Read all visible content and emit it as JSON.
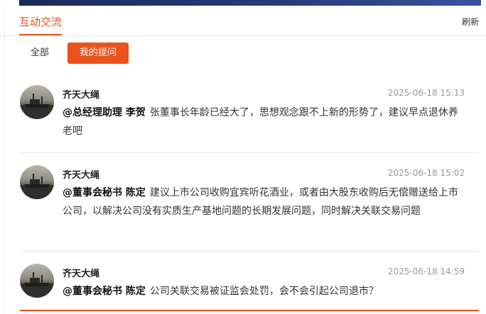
{
  "header": {
    "title": "互动交流",
    "refresh_label": "刷新"
  },
  "tabs": {
    "all_label": "全部",
    "mine_label": "我的提问"
  },
  "posts": [
    {
      "user": "齐天大绳",
      "time": "2025-06-18 15:13",
      "mention": "@总经理助理 李贺",
      "text": "张董事长年龄已经大了，思想观念跟不上新的形势了，建议早点退休养老吧"
    },
    {
      "user": "齐天大绳",
      "time": "2025-06-18 15:02",
      "mention": "@董事会秘书 陈定",
      "text": "建议上市公司收购宜宾听花酒业，或者由大股东收购后无偿赠送给上市公司，以解决公司没有实质生产基地问题的长期发展问题，同时解决关联交易问题"
    },
    {
      "user": "齐天大绳",
      "time": "2025-06-18 14:59",
      "mention": "@董事会秘书 陈定",
      "text": "公司关联交易被证监会处罚，会不会引起公司退市？"
    }
  ]
}
